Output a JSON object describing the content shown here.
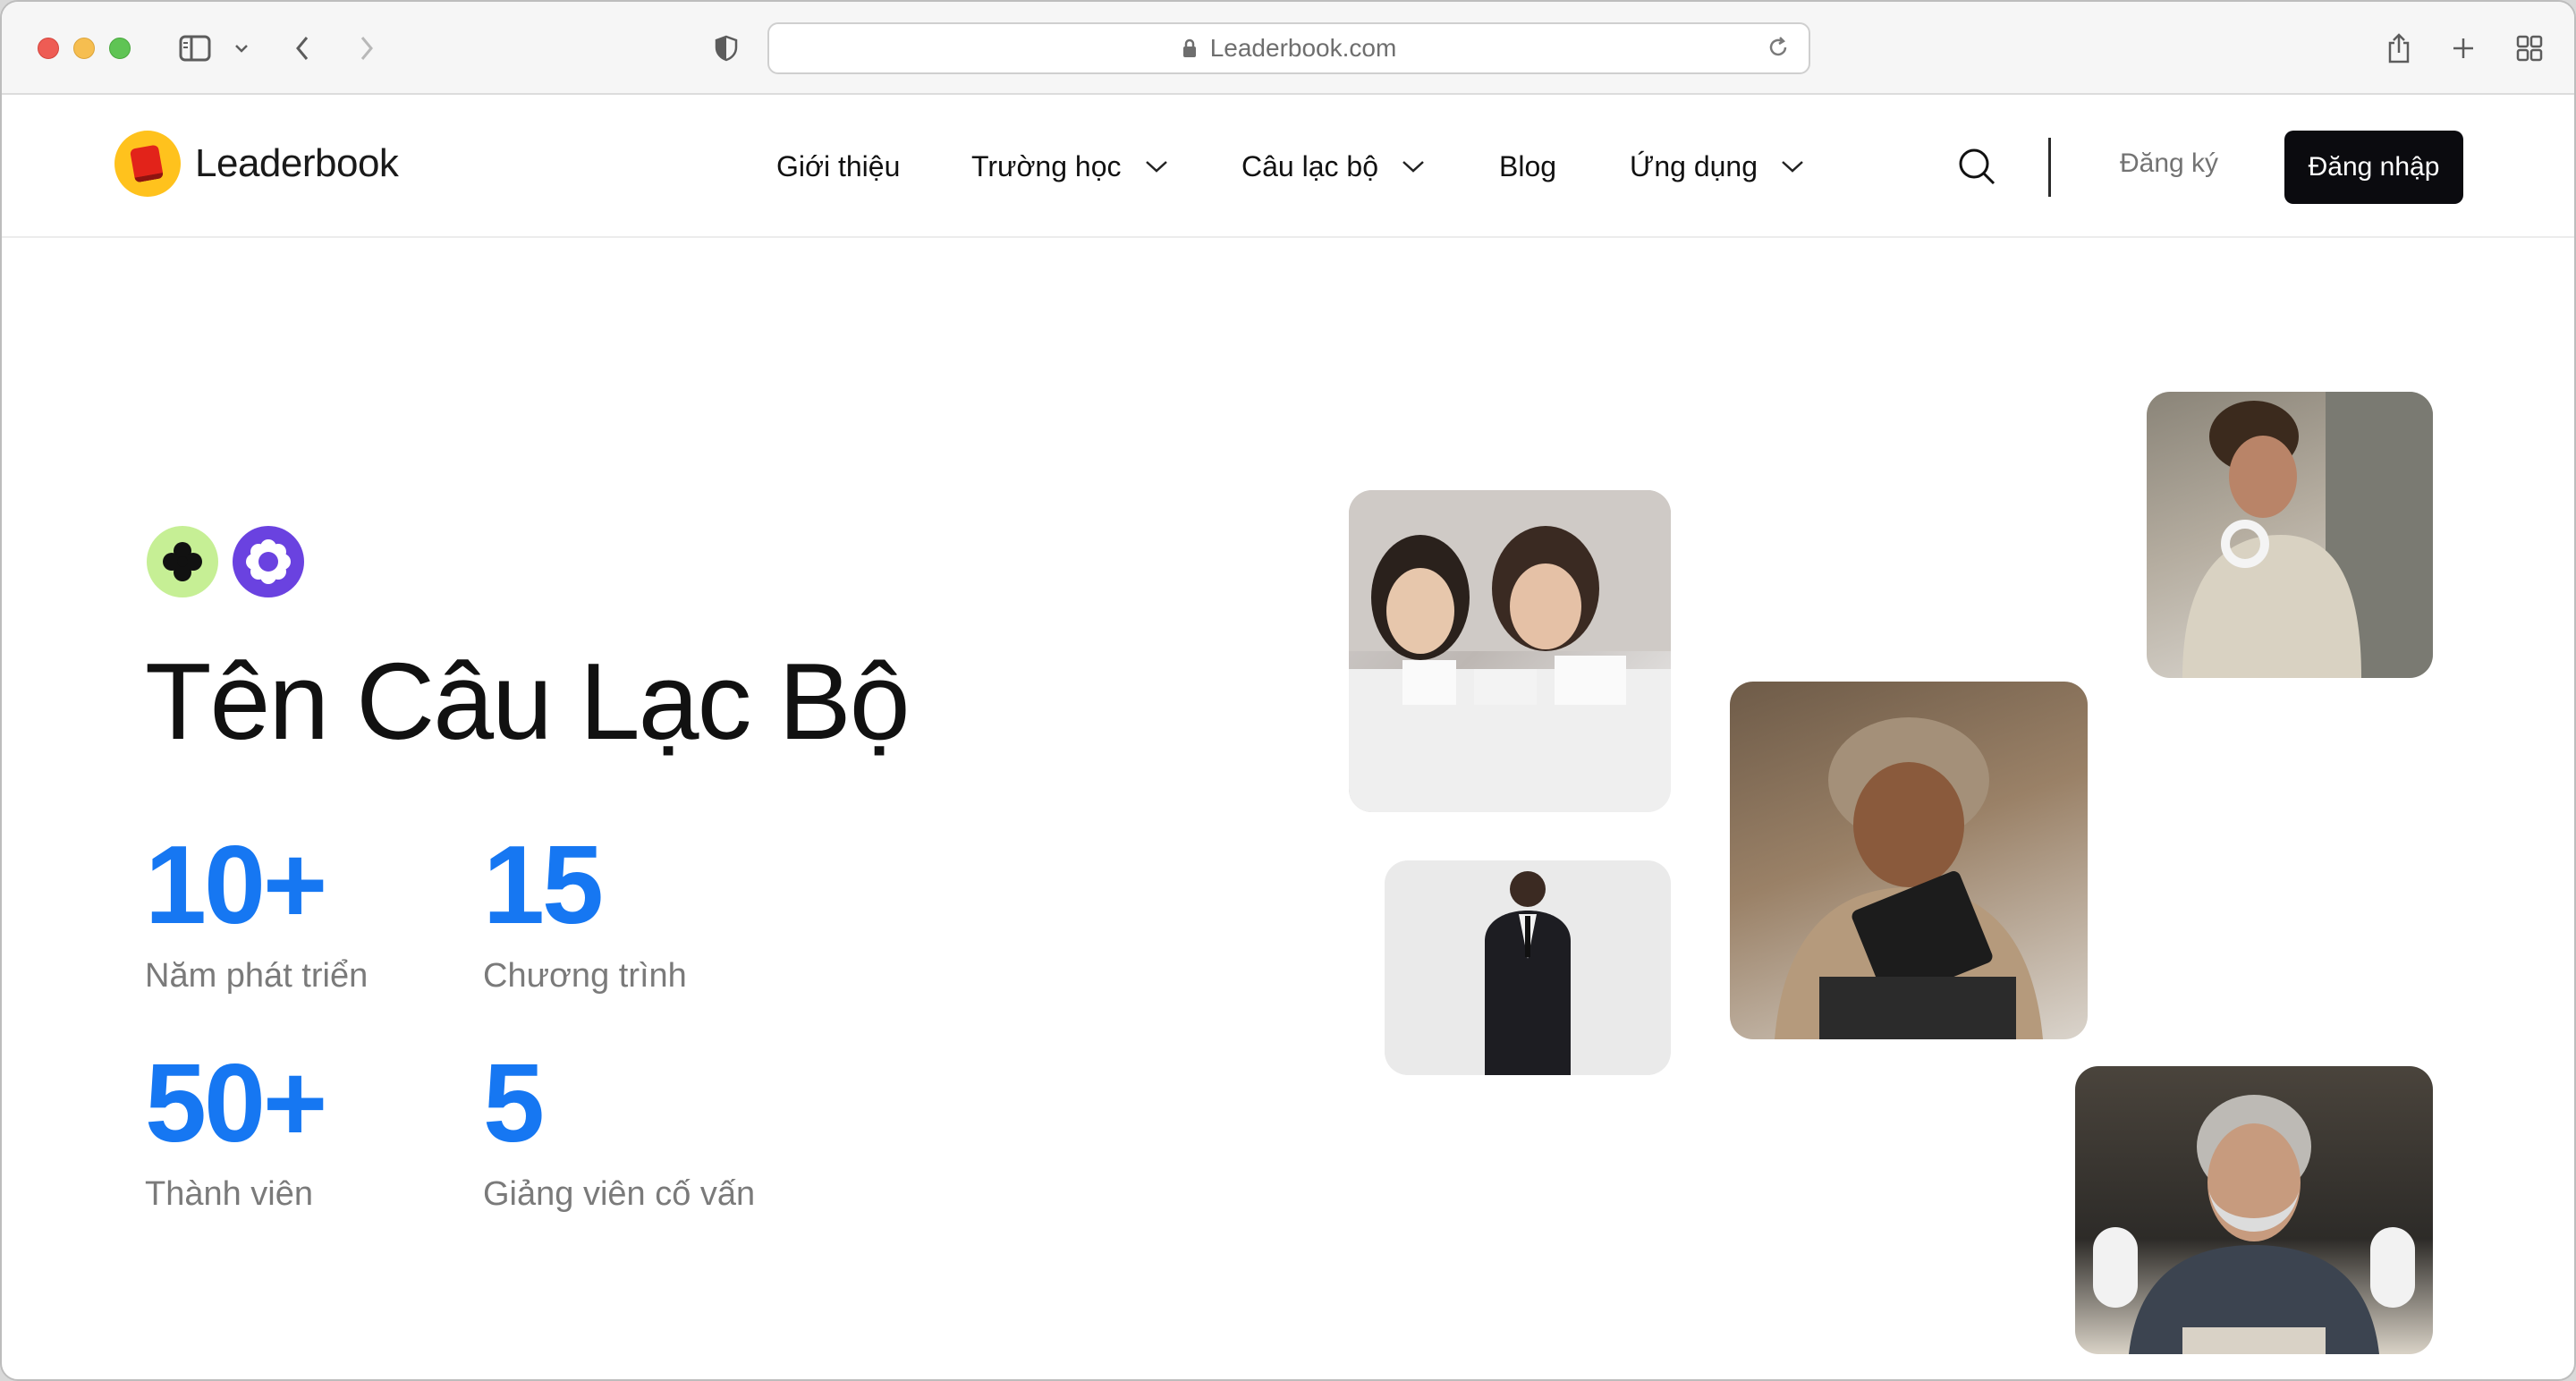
{
  "browser": {
    "url": "Leaderbook.com"
  },
  "header": {
    "logo_text": "Leaderbook",
    "nav": [
      {
        "label": "Giới thiệu",
        "has_dropdown": false
      },
      {
        "label": "Trường học",
        "has_dropdown": true
      },
      {
        "label": "Câu lạc bộ",
        "has_dropdown": true
      },
      {
        "label": "Blog",
        "has_dropdown": false
      },
      {
        "label": "Ứng dụng",
        "has_dropdown": true
      }
    ],
    "signup_label": "Đăng ký",
    "login_label": "Đăng nhập"
  },
  "hero": {
    "title": "Tên Câu Lạc Bộ",
    "stats": [
      {
        "value": "10+",
        "label": "Năm phát triển"
      },
      {
        "value": "15",
        "label": "Chương trình"
      },
      {
        "value": "50+",
        "label": "Thành viên"
      },
      {
        "value": "5",
        "label": "Giảng viên cố vấn"
      }
    ]
  },
  "icons": {
    "badge_1": "clover-icon",
    "badge_2": "flower-icon"
  },
  "colors": {
    "accent": "#1677f2",
    "login_bg": "#0b0b0f",
    "logo_yellow": "#ffc21d",
    "logo_red": "#e2231a",
    "badge_green": "#c6ef95",
    "badge_purple": "#6a42e0"
  }
}
